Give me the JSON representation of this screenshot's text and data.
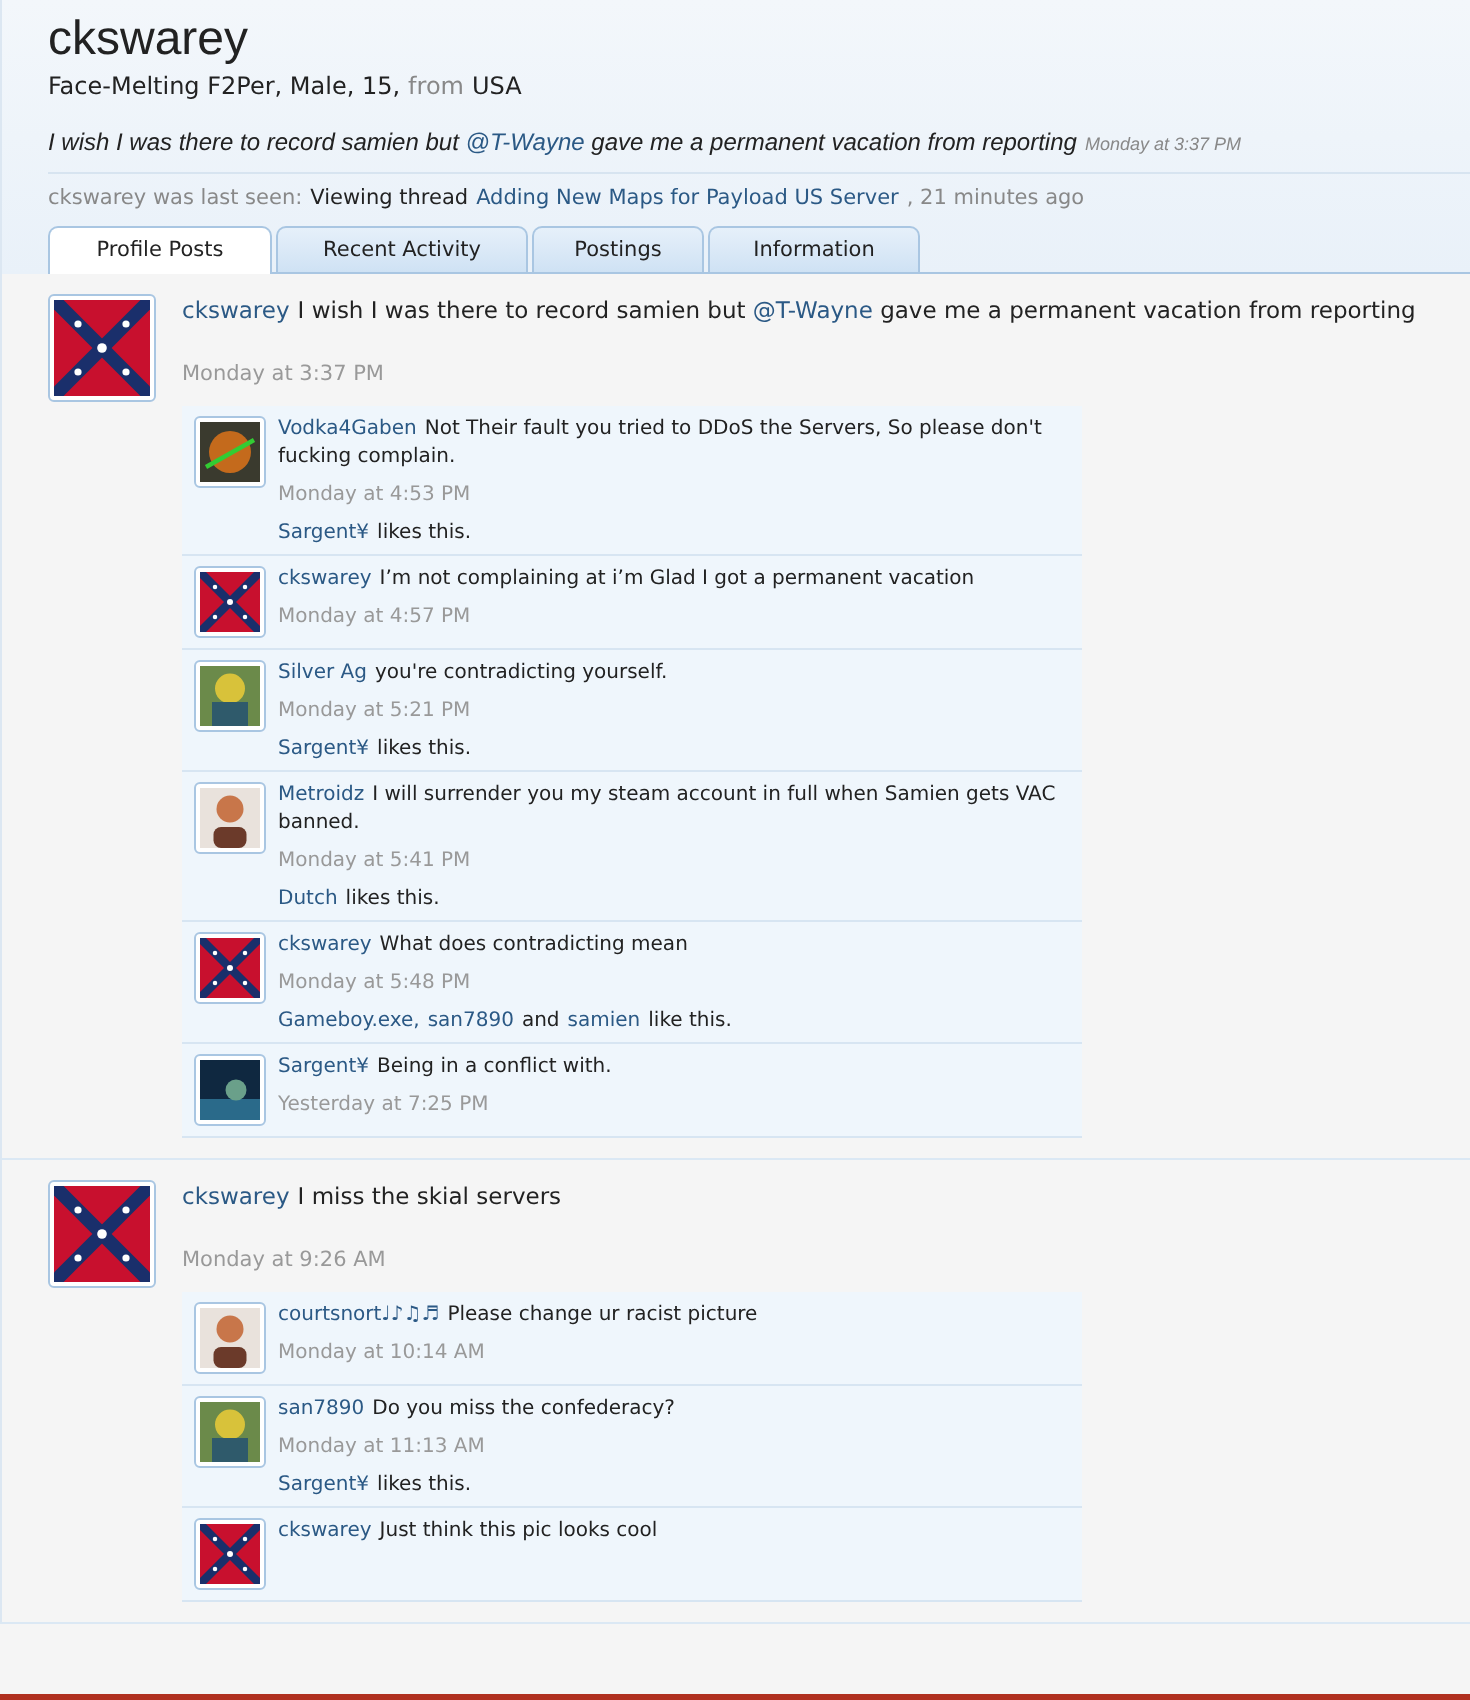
{
  "profile": {
    "name": "ckswarey",
    "info": [
      {
        "text": "Face-Melting F2Per, Male, 15,",
        "muted": false
      },
      {
        "text": "from",
        "muted": true
      },
      {
        "text": "USA",
        "muted": false
      }
    ],
    "status": [
      {
        "text": "I wish I was there to record samien but ",
        "link": false
      },
      {
        "text": "@T-Wayne",
        "link": true
      },
      {
        "text": " gave me a permanent vacation from reporting",
        "link": false
      }
    ],
    "status_time": "Monday at 3:37 PM",
    "last_seen": [
      {
        "text": "ckswarey was last seen:",
        "kind": "muted"
      },
      {
        "text": "Viewing thread",
        "kind": "plain"
      },
      {
        "text": "Adding New Maps for Payload US Server",
        "kind": "link"
      },
      {
        "text": ", 21 minutes ago",
        "kind": "muted"
      }
    ]
  },
  "tabs": [
    {
      "label": "Profile Posts",
      "selected": true
    },
    {
      "label": "Recent Activity",
      "selected": false
    },
    {
      "label": "Postings",
      "selected": false
    },
    {
      "label": "Information",
      "selected": false
    }
  ],
  "posts": [
    {
      "author": "ckswarey",
      "message": [
        {
          "text": "I wish I was there to record samien but ",
          "link": false
        },
        {
          "text": "@T-Wayne",
          "link": true
        },
        {
          "text": " gave me a permanent vacation from reporting",
          "link": false
        }
      ],
      "time": "Monday at 3:37 PM",
      "comments": [
        {
          "author": "Vodka4Gaben",
          "text": "Not Their fault you tried to DDoS the Servers, So please don't fucking complain.",
          "time": "Monday at 4:53 PM",
          "likes": [
            {
              "text": "Sargent¥",
              "link": true
            },
            {
              "text": "likes this.",
              "link": false
            }
          ]
        },
        {
          "author": "ckswarey",
          "text": "I’m not complaining at i’m Glad I got a permanent vacation",
          "time": "Monday at 4:57 PM"
        },
        {
          "author": "Silver Ag",
          "text": "you're contradicting yourself.",
          "time": "Monday at 5:21 PM",
          "likes": [
            {
              "text": "Sargent¥",
              "link": true
            },
            {
              "text": "likes this.",
              "link": false
            }
          ]
        },
        {
          "author": "Metroidz",
          "text": "I will surrender you my steam account in full when Samien gets VAC banned.",
          "time": "Monday at 5:41 PM",
          "likes": [
            {
              "text": "Dutch",
              "link": true
            },
            {
              "text": "likes this.",
              "link": false
            }
          ]
        },
        {
          "author": "ckswarey",
          "text": "What does contradicting mean",
          "time": "Monday at 5:48 PM",
          "likes": [
            {
              "text": "Gameboy.exe,",
              "link": true
            },
            {
              "text": "san7890",
              "link": true
            },
            {
              "text": "and",
              "link": false
            },
            {
              "text": "samien",
              "link": true
            },
            {
              "text": "like this.",
              "link": false
            }
          ]
        },
        {
          "author": "Sargent¥",
          "text": "Being in a conflict with.",
          "time": "Yesterday at 7:25 PM"
        }
      ]
    },
    {
      "author": "ckswarey",
      "message": [
        {
          "text": "I miss the skial servers",
          "link": false
        }
      ],
      "time": "Monday at 9:26 AM",
      "comments": [
        {
          "author": "courtsnort♩♪♫♬",
          "text": "Please change ur racist picture",
          "time": "Monday at 10:14 AM"
        },
        {
          "author": "san7890",
          "text": "Do you miss the confederacy?",
          "time": "Monday at 11:13 AM",
          "likes": [
            {
              "text": "Sargent¥",
              "link": true
            },
            {
              "text": "likes this.",
              "link": false
            }
          ]
        },
        {
          "author": "ckswarey",
          "text": "Just think this pic looks cool"
        }
      ]
    }
  ]
}
